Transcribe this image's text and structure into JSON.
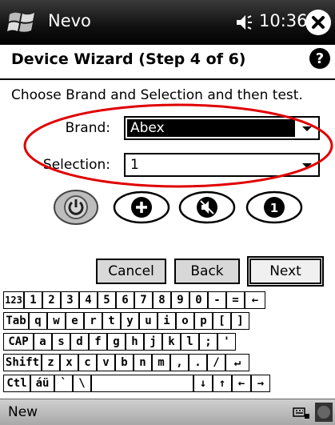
{
  "titlebar": {
    "app_title": "Nevo",
    "clock": "10:36",
    "start_icon": "windows-flag-icon",
    "volume_icon": "speaker-icon",
    "close_icon": "close-icon"
  },
  "header": {
    "title": "Device Wizard (Step 4 of 6)",
    "help_icon": "question-icon"
  },
  "instruction": "Choose Brand and Selection and then test.",
  "form": {
    "brand_label": "Brand:",
    "brand_value": "Abex",
    "selection_label": "Selection:",
    "selection_value": "1"
  },
  "test_buttons": [
    {
      "icon": "power-icon"
    },
    {
      "icon": "plus-icon"
    },
    {
      "icon": "mute-icon"
    },
    {
      "label": "1"
    }
  ],
  "buttons": {
    "cancel": "Cancel",
    "back": "Back",
    "next": "Next"
  },
  "keyboard": {
    "rows": [
      [
        "123",
        "1",
        "2",
        "3",
        "4",
        "5",
        "6",
        "7",
        "8",
        "9",
        "0",
        "-",
        "=",
        "←"
      ],
      [
        "Tab",
        "q",
        "w",
        "e",
        "r",
        "t",
        "y",
        "u",
        "i",
        "o",
        "p",
        "[",
        "]"
      ],
      [
        "CAP",
        "a",
        "s",
        "d",
        "f",
        "g",
        "h",
        "j",
        "k",
        "l",
        ";",
        "'"
      ],
      [
        "Shift",
        "z",
        "x",
        "c",
        "v",
        "b",
        "n",
        "m",
        ",",
        ".",
        "/",
        "↵"
      ],
      [
        "Ctl",
        "áü",
        "`",
        "\\",
        "",
        "↓",
        "↑",
        "←",
        "→"
      ]
    ]
  },
  "menubar": {
    "left": "New",
    "sip_icon": "keyboard-icon"
  },
  "colors": {
    "titlebar": "#111111",
    "highlight_ellipse": "#e00000",
    "selection_bg": "#000000"
  }
}
